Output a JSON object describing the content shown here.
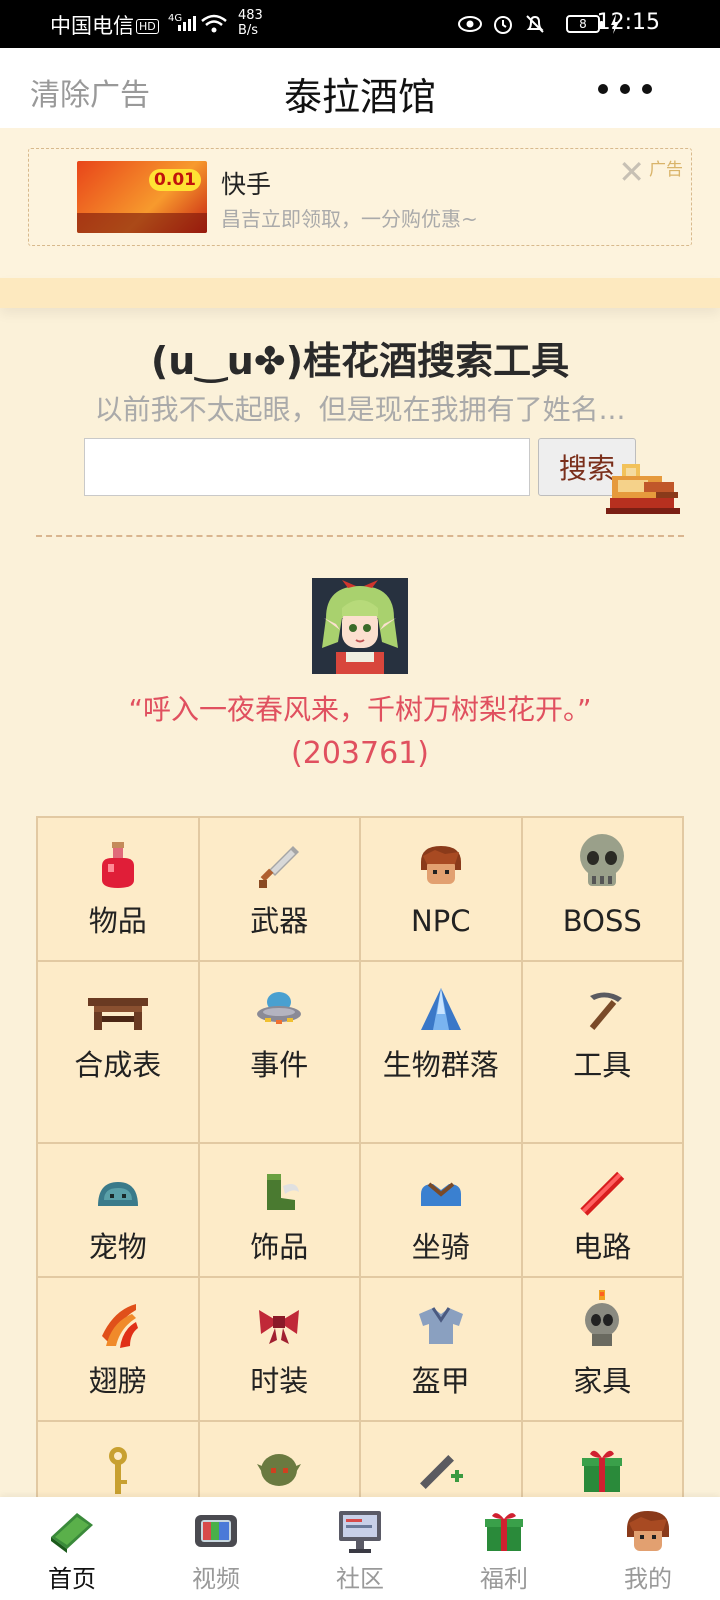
{
  "status_bar": {
    "carrier": "中国电信",
    "hd": "HD",
    "network": "4G",
    "speed_value": "483",
    "speed_unit": "B/s",
    "battery": "8",
    "time": "12:15"
  },
  "header": {
    "clear_ads": "清除广告",
    "title": "泰拉酒馆"
  },
  "ad": {
    "name": "快手",
    "description": "昌吉立即领取，一分购优惠~",
    "price_badge": "0.01",
    "tag": "广告"
  },
  "search": {
    "title": "(u‿u✤)桂花酒搜索工具",
    "subtitle": "以前我不太起眼，但是现在我拥有了姓名...",
    "button": "搜索",
    "value": ""
  },
  "quote": {
    "text": "“呼入一夜春风来，千树万树梨花开。”",
    "id": "(203761)"
  },
  "grid": {
    "items": [
      {
        "label": "物品",
        "icon": "potion-icon"
      },
      {
        "label": "武器",
        "icon": "sword-icon"
      },
      {
        "label": "NPC",
        "icon": "npc-head-icon"
      },
      {
        "label": "BOSS",
        "icon": "skull-icon"
      },
      {
        "label": "合成表",
        "icon": "workbench-icon"
      },
      {
        "label": "事件",
        "icon": "ufo-icon"
      },
      {
        "label": "生物群落",
        "icon": "crystal-icon"
      },
      {
        "label": "工具",
        "icon": "pickaxe-icon"
      },
      {
        "label": "宠物",
        "icon": "slime-icon"
      },
      {
        "label": "饰品",
        "icon": "boots-icon"
      },
      {
        "label": "坐骑",
        "icon": "saddle-icon"
      },
      {
        "label": "电路",
        "icon": "wrench-icon"
      },
      {
        "label": "翅膀",
        "icon": "wings-icon"
      },
      {
        "label": "时装",
        "icon": "bow-icon"
      },
      {
        "label": "盔甲",
        "icon": "armor-icon"
      },
      {
        "label": "家具",
        "icon": "skull-lantern-icon"
      },
      {
        "label": "",
        "icon": "key-icon"
      },
      {
        "label": "",
        "icon": "goblin-icon"
      },
      {
        "label": "",
        "icon": "tool-plus-icon"
      },
      {
        "label": "",
        "icon": "gift-icon"
      }
    ]
  },
  "tabbar": {
    "items": [
      {
        "label": "首页",
        "icon": "book-icon",
        "active": true
      },
      {
        "label": "视频",
        "icon": "tv-icon"
      },
      {
        "label": "社区",
        "icon": "monitor-icon"
      },
      {
        "label": "福利",
        "icon": "gift-icon"
      },
      {
        "label": "我的",
        "icon": "user-head-icon"
      }
    ]
  },
  "colors": {
    "background": "#fbf1d9",
    "grid_cell": "#fdebc8",
    "quote": "#e0505f",
    "header_bg": "#ffffff"
  }
}
